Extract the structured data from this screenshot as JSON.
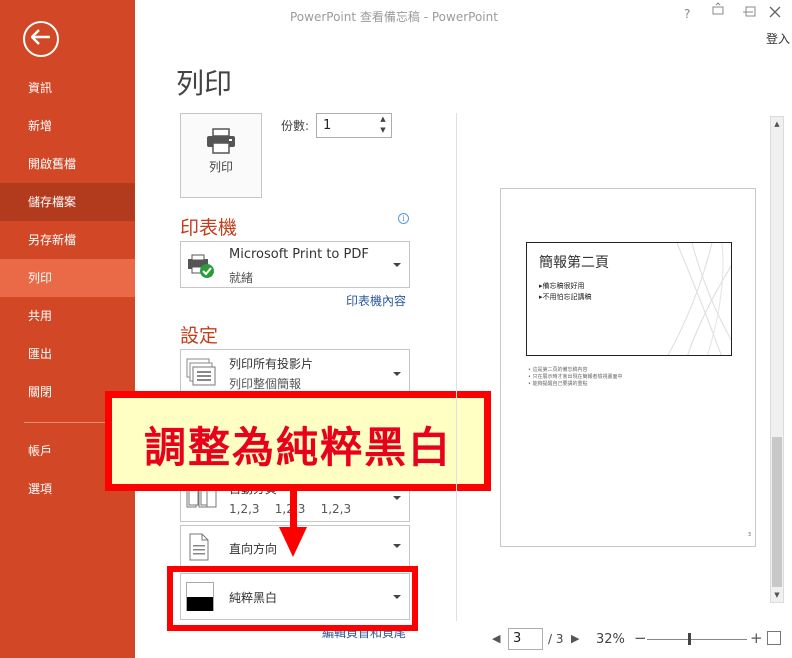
{
  "window": {
    "title": "PowerPoint 查看備忘稿 - PowerPoint",
    "help": "?",
    "signin": "登入"
  },
  "sidebar": {
    "items": [
      {
        "label": "資訊"
      },
      {
        "label": "新增"
      },
      {
        "label": "開啟舊檔"
      },
      {
        "label": "儲存檔案"
      },
      {
        "label": "另存新檔"
      },
      {
        "label": "列印"
      },
      {
        "label": "共用"
      },
      {
        "label": "匯出"
      },
      {
        "label": "關閉"
      },
      {
        "label": "帳戶"
      },
      {
        "label": "選項"
      }
    ],
    "active": "列印",
    "hovered": "儲存檔案"
  },
  "main": {
    "title": "列印",
    "print_button": "列印",
    "copies_label": "份數:",
    "copies_value": "1",
    "printer_heading": "印表機",
    "printer": {
      "name": "Microsoft Print to PDF",
      "status": "就緒"
    },
    "printer_props_link": "印表機內容",
    "settings_heading": "設定",
    "slides": {
      "main": "列印所有投影片",
      "sub": "列印整個簡報"
    },
    "collate": {
      "main": "自動分頁",
      "sub": "1,2,3    1,2,3    1,2,3"
    },
    "orientation": {
      "main": "直向方向"
    },
    "color": {
      "main": "純粹黑白"
    },
    "edit_header_link": "編輯頁首和頁尾"
  },
  "callout": {
    "text": "調整為純粹黑白"
  },
  "preview": {
    "slide_title": "簡報第二頁",
    "bullets": [
      "備忘稿很好用",
      "不用怕忘記講稿"
    ],
    "notes": [
      "這是第二頁的備忘稿內容",
      "只在展示時才會出現在簡報者檢視畫面中",
      "能夠提醒自己要講的重點"
    ],
    "page_number": "3"
  },
  "footer": {
    "current_page": "3",
    "total_pages": "/ 3",
    "zoom": "32%"
  },
  "colors": {
    "sidebar": "#d24726",
    "sidebar_active": "#ea6a47",
    "accent_heading": "#c43e1c",
    "callout_border": "#ff0000",
    "callout_fill": "#ffffc4",
    "callout_text": "#e8001c"
  }
}
